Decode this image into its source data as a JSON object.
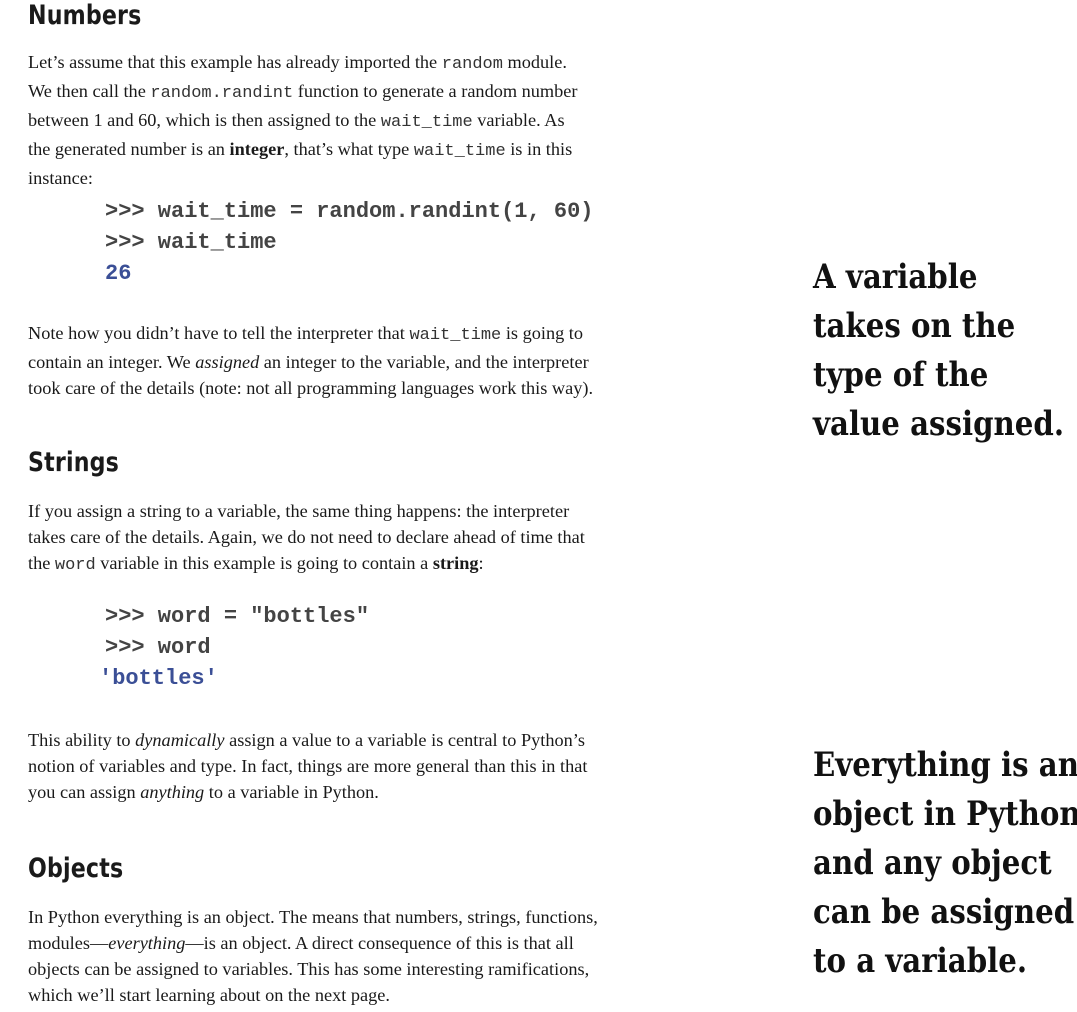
{
  "sections": {
    "numbers": {
      "heading": "Numbers",
      "intro_lines": [
        [
          {
            "t": "Let’s assume that this example has already imported the "
          },
          {
            "t": "random",
            "code": true
          },
          {
            "t": " module."
          }
        ],
        [
          {
            "t": "We then call the "
          },
          {
            "t": "random.randint",
            "code": true
          },
          {
            "t": " function to generate a random number"
          }
        ],
        [
          {
            "t": "between 1 and 60, which is then assigned to the "
          },
          {
            "t": "wait_time",
            "code": true
          },
          {
            "t": " variable. As"
          }
        ],
        [
          {
            "t": "the generated number is an "
          },
          {
            "t": "integer",
            "b": true
          },
          {
            "t": ", that’s what type "
          },
          {
            "t": "wait_time",
            "code": true
          },
          {
            "t": " is in this"
          }
        ],
        [
          {
            "t": "instance:"
          }
        ]
      ],
      "code": [
        {
          "text": ">>> wait_time = random.randint(1, 60)"
        },
        {
          "text": ">>> wait_time"
        },
        {
          "text": "26",
          "output": true
        }
      ],
      "note_lines": [
        [
          {
            "t": "Note how you didn’t have to tell the interpreter that "
          },
          {
            "t": "wait_time",
            "code": true
          },
          {
            "t": " is going to"
          }
        ],
        [
          {
            "t": "contain an integer. We "
          },
          {
            "t": "assigned",
            "i": true
          },
          {
            "t": " an integer to the variable, and the interpreter"
          }
        ],
        [
          {
            "t": "took care of the details (note: not all programming languages work this way)."
          }
        ]
      ]
    },
    "strings": {
      "heading": "Strings",
      "intro_lines": [
        [
          {
            "t": "If you assign a string to a variable, the same thing happens: the interpreter"
          }
        ],
        [
          {
            "t": "takes care of the details. Again, we do not need to declare ahead of time that"
          }
        ],
        [
          {
            "t": "the "
          },
          {
            "t": "word",
            "code": true
          },
          {
            "t": " variable in this example is going to contain a "
          },
          {
            "t": "string",
            "b": true
          },
          {
            "t": ":"
          }
        ]
      ],
      "code": [
        {
          "text": ">>> word = \"bottles\""
        },
        {
          "text": ">>> word"
        },
        {
          "text": "'bottles'",
          "output": true
        }
      ],
      "note_lines": [
        [
          {
            "t": "This ability to "
          },
          {
            "t": "dynamically",
            "i": true
          },
          {
            "t": " assign a value to a variable is central to Python’s"
          }
        ],
        [
          {
            "t": "notion of variables and type. In fact, things are more general than this in that"
          }
        ],
        [
          {
            "t": "you can assign "
          },
          {
            "t": "anything",
            "i": true
          },
          {
            "t": " to a variable in Python."
          }
        ]
      ]
    },
    "objects": {
      "heading": "Objects",
      "intro_lines": [
        [
          {
            "t": "In Python everything is an object. The means that numbers, strings, functions,"
          }
        ],
        [
          {
            "t": "modules—"
          },
          {
            "t": "everything",
            "i": true
          },
          {
            "t": "—is an object. A direct consequence of this is that all"
          }
        ],
        [
          {
            "t": "objects can be assigned to variables. This has some interesting ramifications,"
          }
        ],
        [
          {
            "t": "which we’ll start learning about on the next page."
          }
        ]
      ]
    }
  },
  "margin_notes": [
    {
      "lines": [
        "A variable",
        "takes on the",
        "type of the",
        "value assigned."
      ]
    },
    {
      "lines": [
        "Everything is an",
        "object in Python,",
        "and any object",
        "can be assigned",
        "to a variable."
      ]
    }
  ]
}
